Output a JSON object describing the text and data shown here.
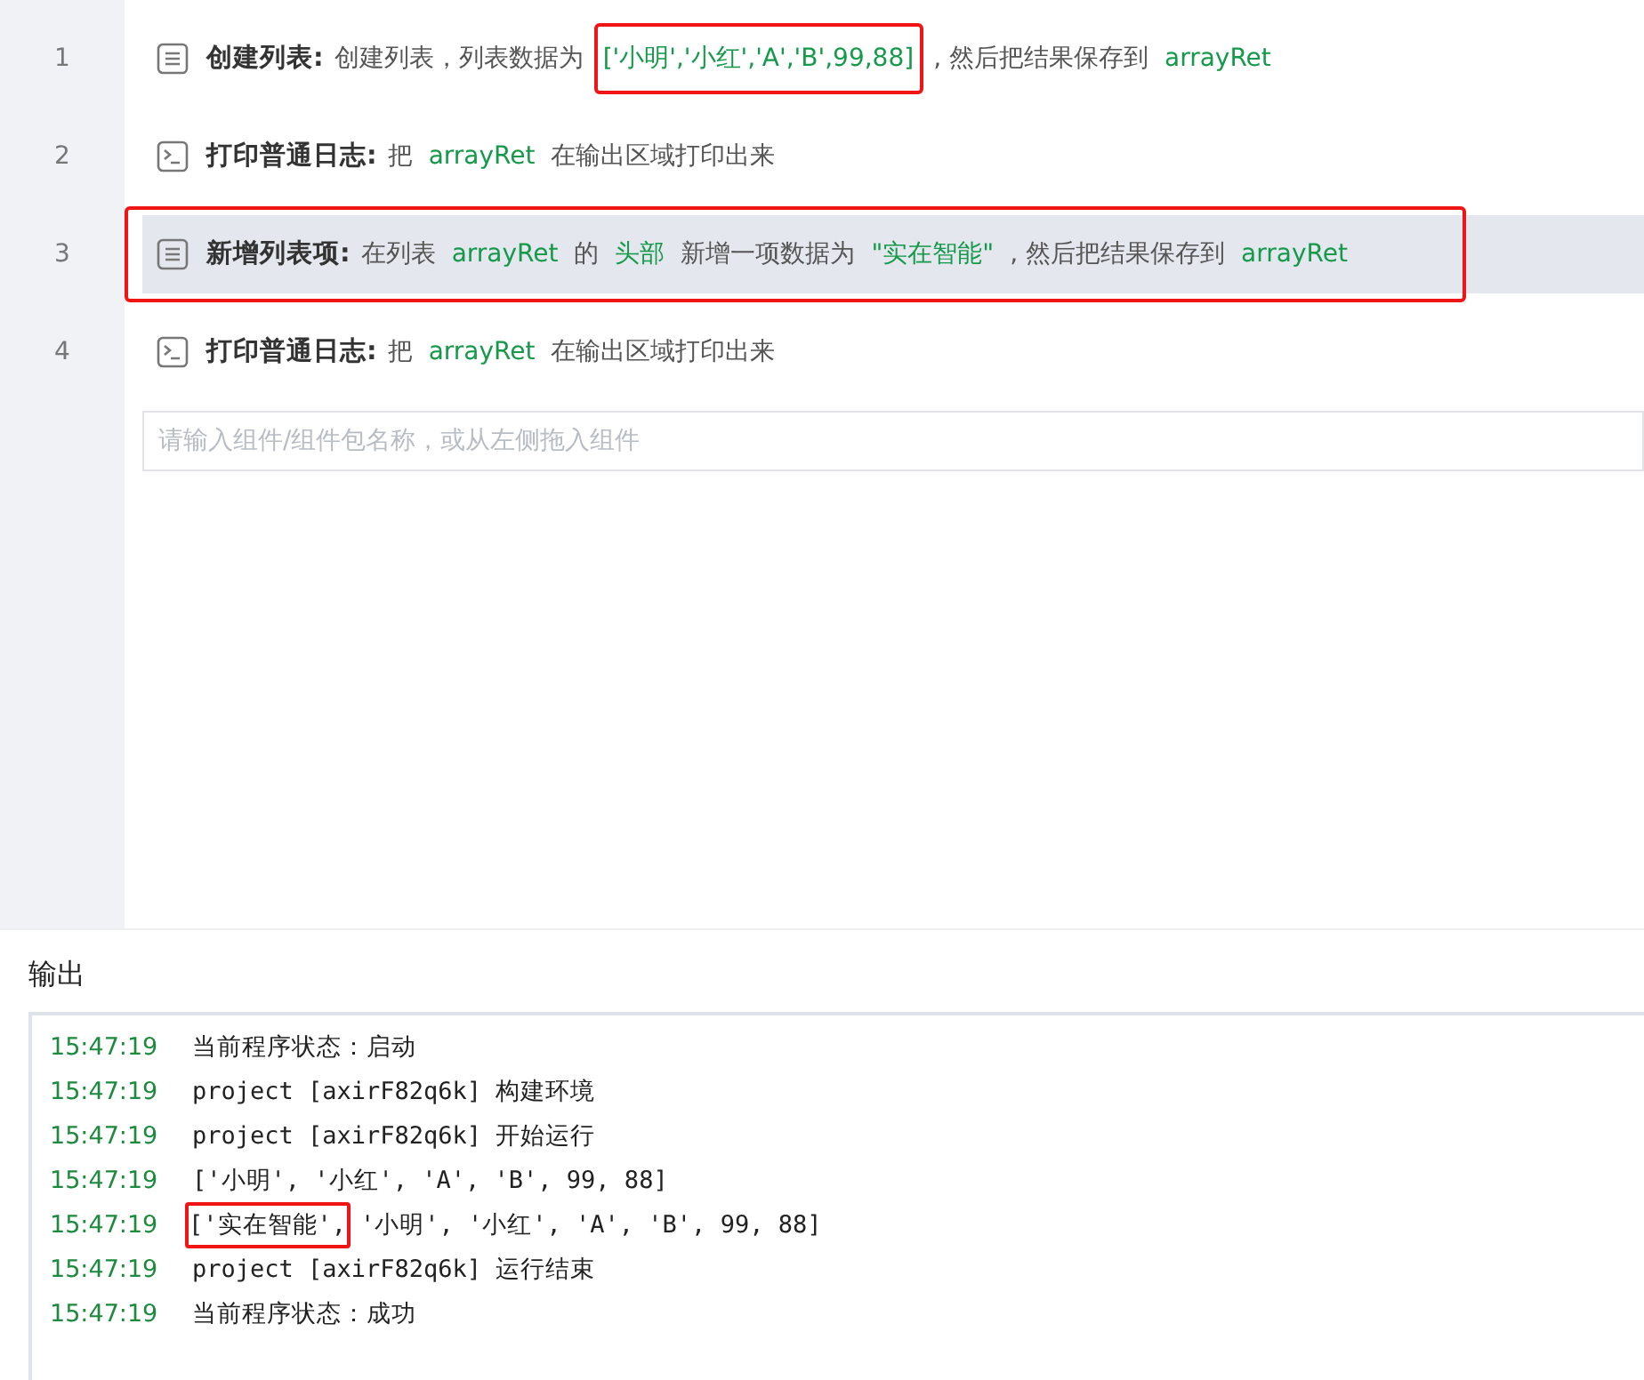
{
  "steps": [
    {
      "number": "1",
      "kind": "list",
      "title": "创建列表:",
      "selected": false,
      "annotated": false,
      "parts": [
        {
          "kind": "text",
          "text": "创建列表，列表数据为",
          "annotated": false
        },
        {
          "kind": "var",
          "text": "['小明','小红','A','B',99,88]",
          "annotated": true
        },
        {
          "kind": "text",
          "text": ", 然后把结果保存到",
          "annotated": false
        },
        {
          "kind": "var",
          "text": "arrayRet",
          "annotated": false
        }
      ]
    },
    {
      "number": "2",
      "kind": "terminal",
      "title": "打印普通日志:",
      "selected": false,
      "annotated": false,
      "parts": [
        {
          "kind": "text",
          "text": "把",
          "annotated": false
        },
        {
          "kind": "var",
          "text": "arrayRet",
          "annotated": false
        },
        {
          "kind": "text",
          "text": "在输出区域打印出来",
          "annotated": false
        }
      ]
    },
    {
      "number": "3",
      "kind": "list",
      "title": "新增列表项:",
      "selected": true,
      "annotated": true,
      "parts": [
        {
          "kind": "text",
          "text": "在列表",
          "annotated": false
        },
        {
          "kind": "var",
          "text": "arrayRet",
          "annotated": false
        },
        {
          "kind": "text",
          "text": "的",
          "annotated": false
        },
        {
          "kind": "var",
          "text": "头部",
          "annotated": false
        },
        {
          "kind": "text",
          "text": "新增一项数据为",
          "annotated": false
        },
        {
          "kind": "var",
          "text": "\"实在智能\"",
          "annotated": false
        },
        {
          "kind": "text",
          "text": ", 然后把结果保存到",
          "annotated": false
        },
        {
          "kind": "var",
          "text": "arrayRet",
          "annotated": false
        }
      ]
    },
    {
      "number": "4",
      "kind": "terminal",
      "title": "打印普通日志:",
      "selected": false,
      "annotated": false,
      "parts": [
        {
          "kind": "text",
          "text": "把",
          "annotated": false
        },
        {
          "kind": "var",
          "text": "arrayRet",
          "annotated": false
        },
        {
          "kind": "text",
          "text": "在输出区域打印出来",
          "annotated": false
        }
      ]
    }
  ],
  "search": {
    "placeholder": "请输入组件/组件包名称，或从左侧拖入组件"
  },
  "output": {
    "title": "输出",
    "lines": [
      {
        "time": "15:47:19",
        "parts": [
          {
            "text": "当前程序状态：启动",
            "annotated": false
          }
        ]
      },
      {
        "time": "15:47:19",
        "parts": [
          {
            "text": "project [axirF82q6k] 构建环境",
            "annotated": false
          }
        ]
      },
      {
        "time": "15:47:19",
        "parts": [
          {
            "text": "project [axirF82q6k] 开始运行",
            "annotated": false
          }
        ]
      },
      {
        "time": "15:47:19",
        "parts": [
          {
            "text": "['小明', '小红', 'A', 'B', 99, 88]",
            "annotated": false
          }
        ]
      },
      {
        "time": "15:47:19",
        "parts": [
          {
            "text": "['实在智能',",
            "annotated": true
          },
          {
            "text": "'小明', '小红', 'A', 'B', 99, 88]",
            "annotated": false
          }
        ]
      },
      {
        "time": "15:47:19",
        "parts": [
          {
            "text": "project [axirF82q6k] 运行结束",
            "annotated": false
          }
        ]
      },
      {
        "time": "15:47:19",
        "parts": [
          {
            "text": "当前程序状态：成功",
            "annotated": false
          }
        ]
      }
    ]
  }
}
